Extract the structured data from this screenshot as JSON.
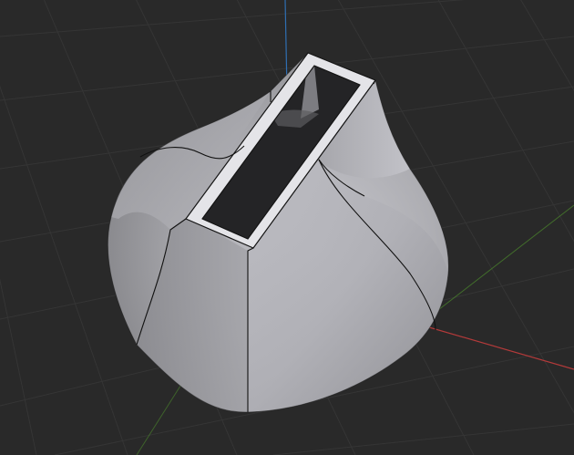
{
  "viewport": {
    "mode": "3d-viewport",
    "background_color": "#292929",
    "grid_color": "#353535",
    "axis_colors": {
      "x_axis": "#b33a3a",
      "y_axis": "#4c8a2c",
      "z_axis": "#2f6fb3"
    }
  },
  "object": {
    "shape": "hollowed funnel/drop solid with rectangular slot opening",
    "surface_color": "#a8a8ad",
    "highlight_color": "#d2d2d8",
    "shadow_color": "#6e6e72",
    "edge_color": "#111111",
    "rim_color": "#e4e4e8",
    "inner_wall_color": "#8a8a8f"
  }
}
